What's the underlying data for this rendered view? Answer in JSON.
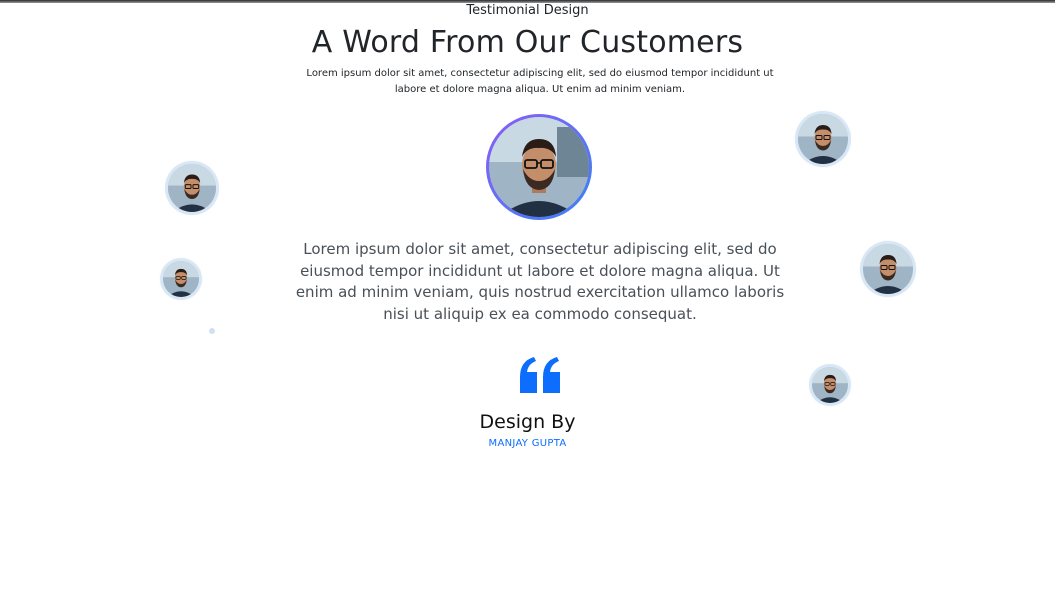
{
  "header": {
    "eyebrow": "Testimonial Design",
    "title": "A Word From Our Customers",
    "lead": "Lorem ipsum dolor sit amet, consectetur adipiscing elit, sed do eiusmod tempor incididunt ut labore et dolore magna aliqua. Ut enim ad minim veniam."
  },
  "testimonial": {
    "text": "Lorem ipsum dolor sit amet, consectetur adipiscing elit, sed do eiusmod tempor incididunt ut labore et dolore magna aliqua. Ut enim ad minim veniam, quis nostrud exercitation ullamco laboris nisi ut aliquip ex ea commodo consequat.",
    "quote_icon": "quote-left-icon",
    "designer_label": "Design By",
    "author": "MANJAY GUPTA"
  },
  "colors": {
    "accent": "#0d6efd",
    "avatar_ring_start": "#8b5cf6",
    "avatar_ring_end": "#3b82f6",
    "float_ring": "#d7e7f5"
  }
}
